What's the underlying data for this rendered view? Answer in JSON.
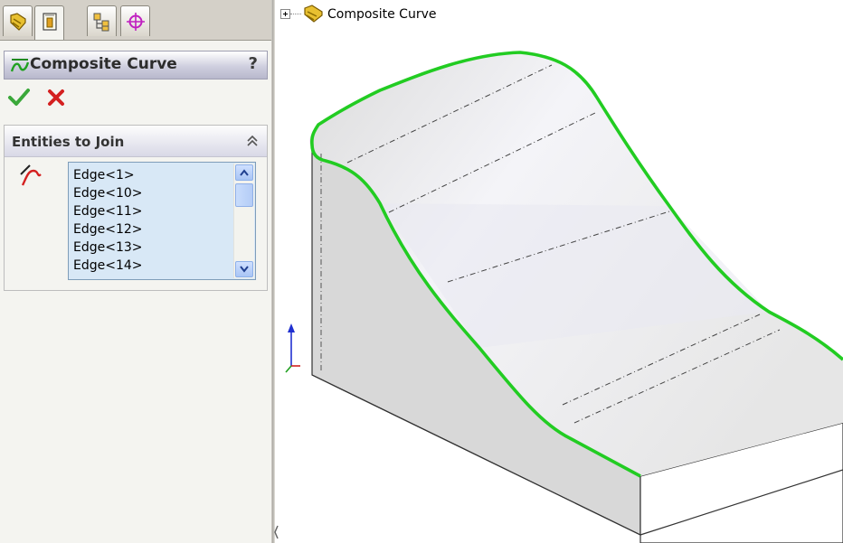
{
  "property_manager": {
    "tabs": [
      {
        "name": "featuremanager-tab",
        "icon": "feature-tree-icon"
      },
      {
        "name": "propertymanager-tab",
        "icon": "property-sheet-icon",
        "active": true
      },
      {
        "name": "configurationmanager-tab",
        "icon": "configuration-icon"
      },
      {
        "name": "dimxpert-tab",
        "icon": "crosshair-icon"
      }
    ],
    "title": "Composite Curve",
    "help_label": "?",
    "ok_icon": "checkmark-icon",
    "cancel_icon": "x-icon",
    "group": {
      "title": "Entities to Join",
      "collapse_icon": "double-chevron-up-icon",
      "selection_icon": "edge-selection-icon",
      "entities": [
        "Edge<1>",
        "Edge<10>",
        "Edge<11>",
        "Edge<12>",
        "Edge<13>",
        "Edge<14>"
      ]
    }
  },
  "feature_tree": {
    "item_label": "Composite Curve",
    "item_icon": "part-feature-icon"
  },
  "colors": {
    "highlight_edge": "#22cc22",
    "list_background": "#d8e8f6",
    "ok_green": "#3aa83a",
    "cancel_red": "#d42020"
  }
}
